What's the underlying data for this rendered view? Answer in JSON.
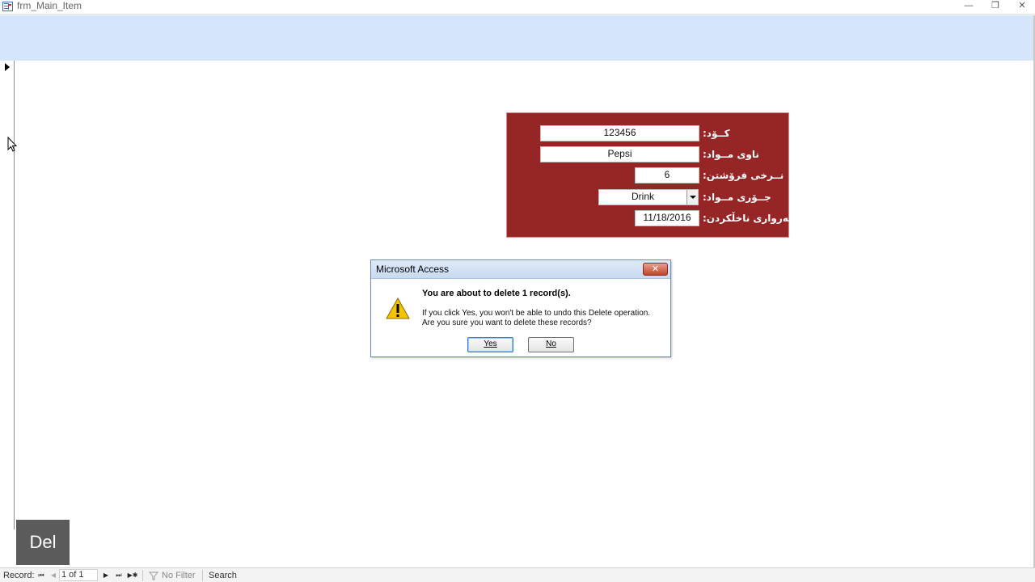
{
  "window": {
    "title": "frm_Main_Item",
    "minimize": "—",
    "restore": "❐",
    "close": "✕"
  },
  "form": {
    "fields": [
      {
        "label": "کــۆد:",
        "value": "123456"
      },
      {
        "label": "ناوی مــواد:",
        "value": "Pepsi"
      },
      {
        "label": "نــرخی فرۆشتن:",
        "value": "6"
      },
      {
        "label": "جــۆری مــواد:",
        "value": "Drink"
      },
      {
        "label": "بەرواری ناخڵکردن:",
        "value": "11/18/2016"
      }
    ],
    "panel_color": "#962526"
  },
  "dialog": {
    "title": "Microsoft Access",
    "heading": "You are about to delete 1 record(s).",
    "message_line1": "If you click Yes, you won't be able to undo this Delete operation.",
    "message_line2": "Are you sure you want to delete these records?",
    "yes_label": "Yes",
    "no_label": "No",
    "close_label": "✕"
  },
  "key_overlay": "Del",
  "navigation": {
    "record_label": "Record:",
    "first": "⏮",
    "prev": "◀",
    "current": "1 of 1",
    "next": "▶",
    "last": "⏭",
    "new": "▶✱",
    "filter_label": "No Filter",
    "search_label": "Search"
  }
}
